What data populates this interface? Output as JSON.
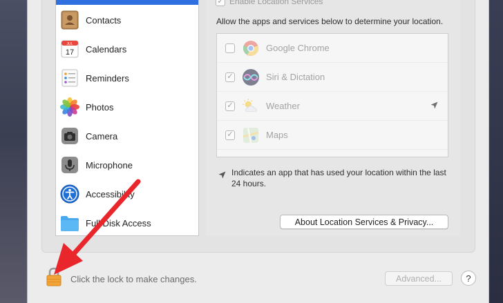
{
  "location": {
    "enable_label": "Enable Location Services",
    "allow_text": "Allow the apps and services below to determine your location.",
    "services": [
      {
        "name": "Google Chrome",
        "checked": false,
        "icon": "chrome-icon",
        "used_recently": false
      },
      {
        "name": "Siri & Dictation",
        "checked": true,
        "icon": "siri-icon",
        "used_recently": false
      },
      {
        "name": "Weather",
        "checked": true,
        "icon": "weather-icon",
        "used_recently": true
      },
      {
        "name": "Maps",
        "checked": true,
        "icon": "maps-icon",
        "used_recently": false
      }
    ],
    "legend_text": "Indicates an app that has used your location within the last 24 hours.",
    "about_button": "About Location Services & Privacy..."
  },
  "sidebar": {
    "items": [
      {
        "label": "Contacts",
        "icon": "contacts-icon"
      },
      {
        "label": "Calendars",
        "icon": "calendar-icon",
        "calendar_month": "JUL",
        "calendar_day": "17"
      },
      {
        "label": "Reminders",
        "icon": "reminders-icon"
      },
      {
        "label": "Photos",
        "icon": "photos-icon"
      },
      {
        "label": "Camera",
        "icon": "camera-icon"
      },
      {
        "label": "Microphone",
        "icon": "microphone-icon"
      },
      {
        "label": "Accessibility",
        "icon": "accessibility-icon"
      },
      {
        "label": "Full Disk Access",
        "icon": "folder-icon"
      }
    ]
  },
  "footer": {
    "lock_text": "Click the lock to make changes.",
    "advanced_button": "Advanced...",
    "help_button": "?"
  },
  "colors": {
    "accent": "#2f6fe0",
    "annotation_arrow": "#e8262b",
    "lock": "#f2a33a"
  }
}
